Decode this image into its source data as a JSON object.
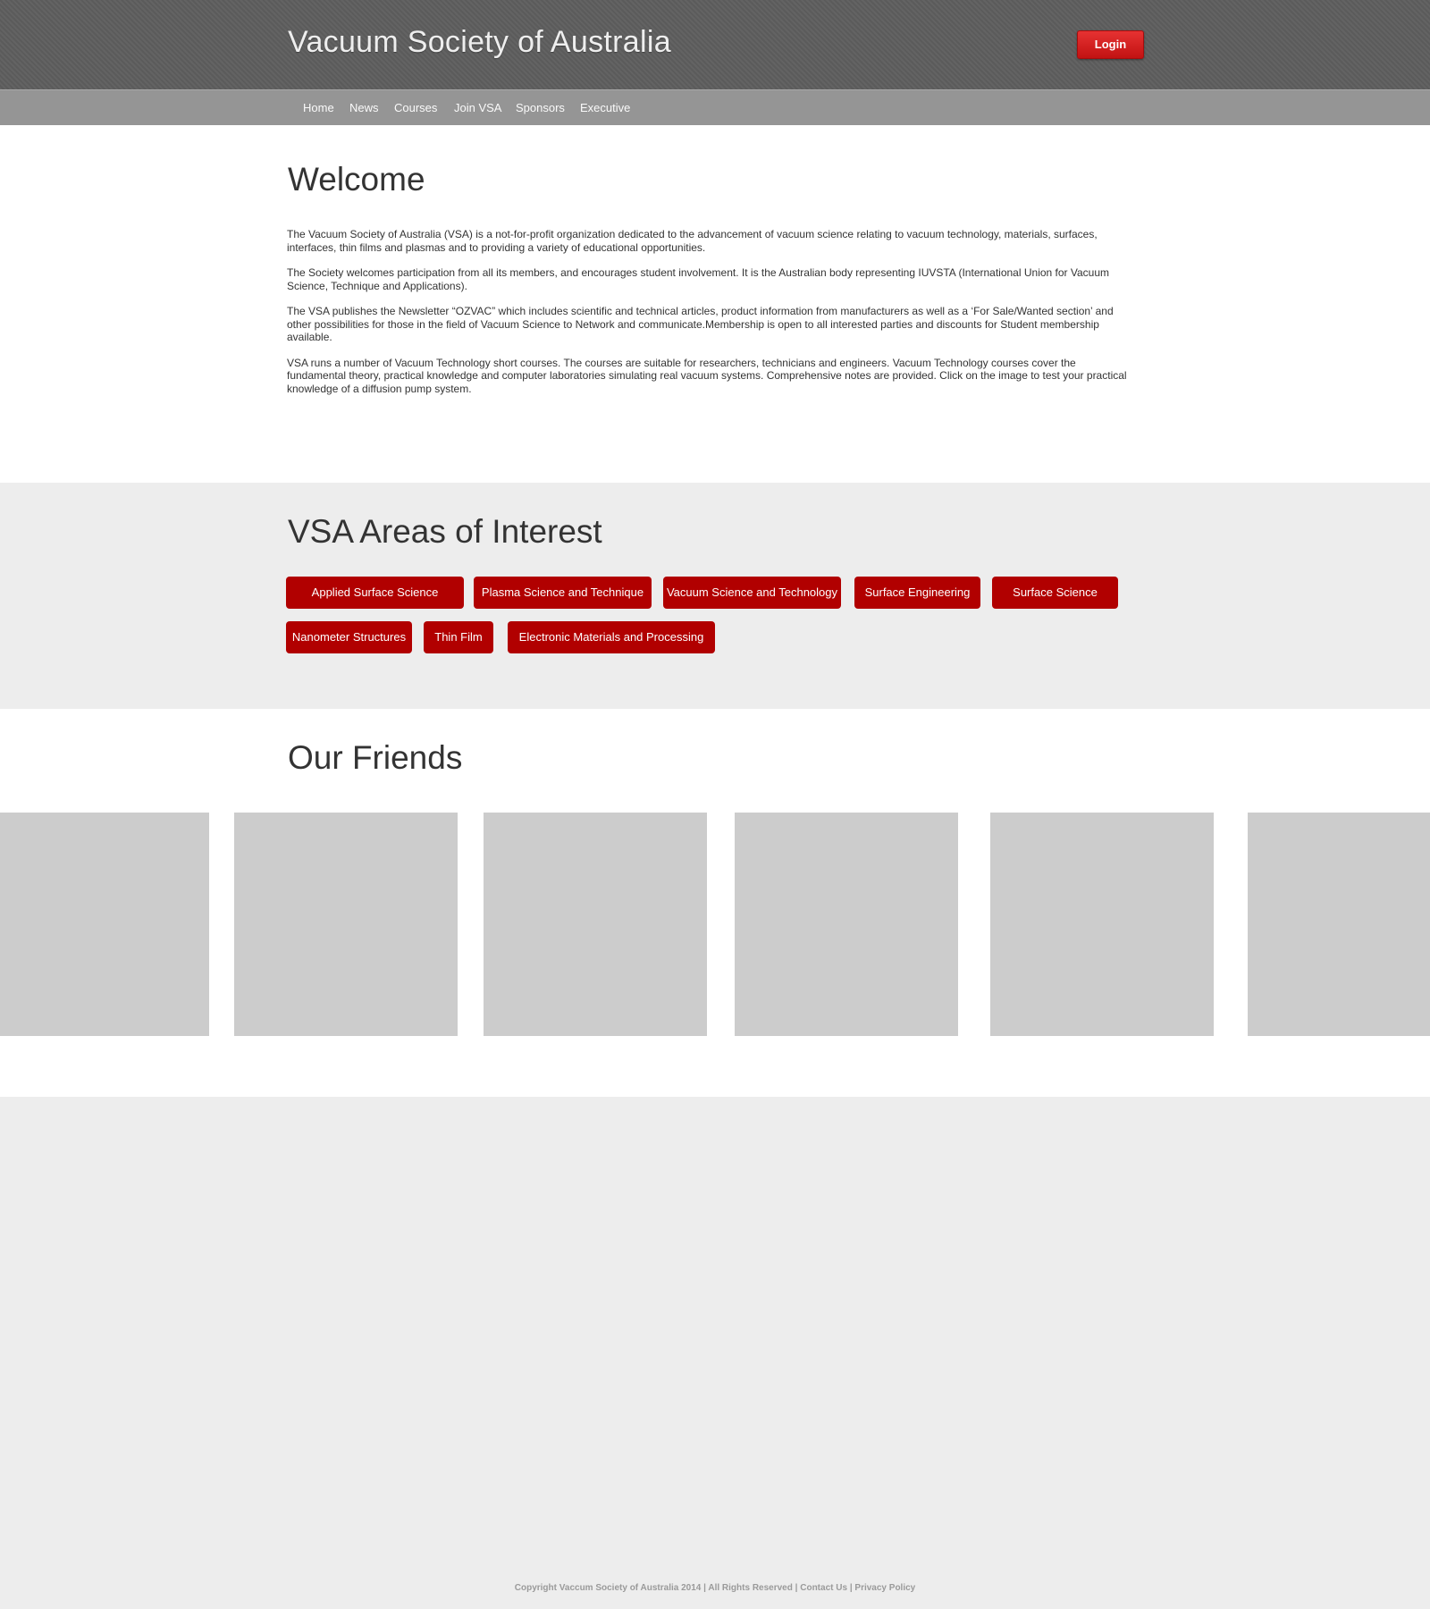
{
  "header": {
    "site_title": "Vacuum Society of Australia",
    "login_label": "Login"
  },
  "nav": {
    "items": [
      "Home",
      "News",
      "Courses",
      "Join VSA",
      "Sponsors",
      "Executive"
    ]
  },
  "welcome": {
    "heading": "Welcome",
    "paragraphs": [
      "The Vacuum Society of Australia (VSA) is a not-for-profit organization dedicated to the advancement of vacuum science relating to vacuum technology, materials, surfaces, interfaces, thin films and plasmas and to providing a variety of educational opportunities.",
      "The Society welcomes participation from all its members, and encourages student involvement. It is the Australian body representing IUVSTA (International Union for Vacuum Science, Technique and Applications).",
      "The VSA publishes the Newsletter “OZVAC” which includes scientific and technical articles, product information from manufacturers as well as a ‘For Sale/Wanted section’ and other possibilities for those in the field of Vacuum Science to Network and communicate.Membership is open to all interested parties and discounts for Student membership available.",
      "VSA runs a number of Vacuum Technology short courses. The courses are suitable for researchers, technicians and engineers. Vacuum Technology courses cover the fundamental theory, practical knowledge and computer laboratories simulating real vacuum systems. Comprehensive notes are provided. Click on the image to test your practical knowledge of a diffusion pump system."
    ]
  },
  "areas": {
    "heading": "VSA Areas of Interest",
    "tags": [
      "Applied Surface Science",
      "Plasma Science and Technique",
      "Vacuum Science and Technology",
      "Surface Engineering",
      "Surface Science",
      "Nanometer Structures",
      "Thin Film",
      "Electronic Materials and Processing"
    ]
  },
  "friends": {
    "heading": "Our Friends"
  },
  "footer": {
    "copyright": "Copyright Vaccum Society of Australia 2014",
    "rights": "All Rights Reserved",
    "separator": "|",
    "contact": "Contact Us",
    "privacy": "Privacy Policy"
  },
  "colors": {
    "header_bg": "#5e5e5e",
    "nav_bg": "#959595",
    "accent_red": "#b10000",
    "login_red": "#d42020",
    "placeholder_gray": "#cccccc",
    "section_gray": "#ededed"
  }
}
